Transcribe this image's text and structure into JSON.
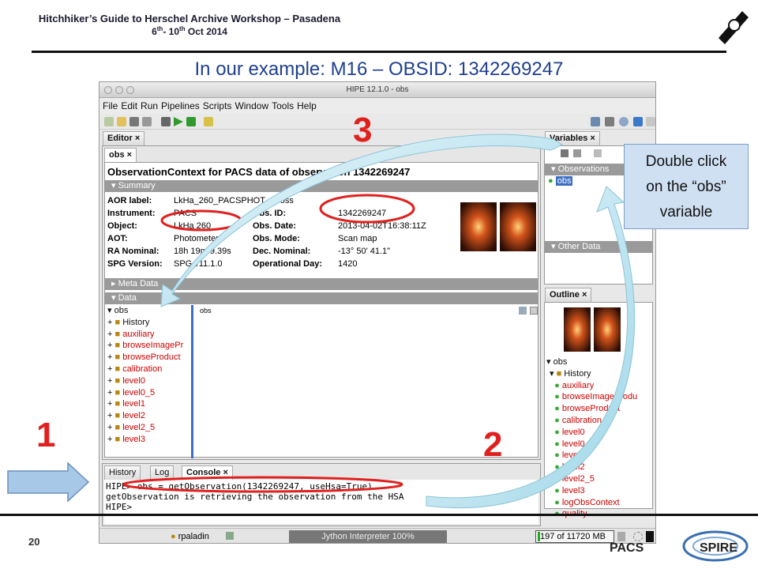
{
  "header": {
    "title": "Hitchhiker’s Guide to Herschel Archive Workshop – Pasadena",
    "date_day1": "6",
    "date_sup1": "th",
    "date_mid": "- 10",
    "date_sup2": "th",
    "date_tail": " Oct 2014",
    "logo_text": "HERSCHEL"
  },
  "slide_title": "In our example: M16 – OBSID: 1342269247",
  "page_number": "20",
  "logos": {
    "pacs": "PACS",
    "spire": "SPIRE"
  },
  "step_labels": {
    "one": "1",
    "two": "2",
    "three": "3"
  },
  "callout": {
    "line1": "Double click",
    "line2": "on the “obs”",
    "line3": "variable"
  },
  "window": {
    "title": "HIPE 12.1.0 - obs",
    "menu": [
      "File",
      "Edit",
      "Run",
      "Pipelines",
      "Scripts",
      "Window",
      "Tools",
      "Help"
    ]
  },
  "editor": {
    "panel_tab": "Editor ×",
    "doc_tab": "obs ×",
    "heading": "ObservationContext for PACS data of observation 1342269247",
    "summary_label": "Summary",
    "fields_left": [
      {
        "label": "AOR label:",
        "value": "LkHa_260_PACSPHOT - cross"
      },
      {
        "label": "Instrument:",
        "value": "PACS"
      },
      {
        "label": "Object:",
        "value": "LkHa 260"
      },
      {
        "label": "AOT:",
        "value": "Photometer"
      },
      {
        "label": "RA Nominal:",
        "value": "18h 19m 9.39s"
      },
      {
        "label": "SPG Version:",
        "value": "SPG v11.1.0"
      }
    ],
    "fields_right": [
      {
        "label": "Obs. ID:",
        "value": "1342269247"
      },
      {
        "label": "Obs. Date:",
        "value": "2013-04-02T16:38:11Z"
      },
      {
        "label": "Obs. Mode:",
        "value": "Scan map"
      },
      {
        "label": "Dec. Nominal:",
        "value": "-13° 50' 41.1\""
      },
      {
        "label": "Operational Day:",
        "value": "1420"
      }
    ],
    "meta_label": "Meta Data",
    "data_label": "Data",
    "tree_root": "obs",
    "tree_items": [
      "History",
      "auxiliary",
      "browseImagePr",
      "browseProduct",
      "calibration",
      "level0",
      "level0_5",
      "level1",
      "level2",
      "level2_5",
      "level3"
    ],
    "data_pane_label": "obs"
  },
  "variables": {
    "panel_tab": "Variables ×",
    "observations_label": "Observations",
    "item": "obs",
    "other_label": "Other Data"
  },
  "outline": {
    "panel_tab": "Outline ×",
    "root": "obs",
    "items": [
      "History",
      "auxiliary",
      "browseImageProdu",
      "browseProduct",
      "calibration",
      "level0",
      "level0_5",
      "level1",
      "level2",
      "level2_5",
      "level3",
      "logObsContext",
      "quality"
    ]
  },
  "console": {
    "tabs": [
      "History",
      "Log",
      "Console ×"
    ],
    "lines": [
      "HIPE> obs = getObservation(1342269247, useHsa=True)",
      "getObservation is retrieving the observation from the HSA",
      "HIPE>"
    ]
  },
  "statusbar": {
    "user": "rpaladin",
    "interpreter": "Jython Interpreter 100%",
    "memory": "197 of 11720 MB"
  },
  "colors": {
    "accent_red": "#e0201e",
    "title_blue": "#1f3f8f",
    "callout_bg": "#cfe0f3"
  }
}
